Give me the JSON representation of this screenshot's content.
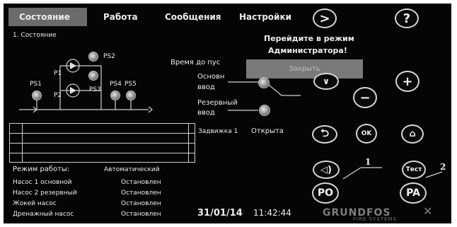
{
  "tabs": [
    {
      "label": "Состояние"
    },
    {
      "label": "Работа"
    },
    {
      "label": "Сообщения"
    },
    {
      "label": "Настройки"
    }
  ],
  "breadcrumb": "1. Состояние",
  "diagram": {
    "ps1": "PS1",
    "ps2": "PS2",
    "ps3": "PS3",
    "ps4": "PS4",
    "ps5": "PS5",
    "p1": "P1",
    "p2": "P2"
  },
  "admin_prompt": {
    "line1": "Перейдите в режим",
    "line2": "Администратора!",
    "close_label": "Закрыть"
  },
  "time_label": "Время до пус",
  "inputs": {
    "main_line1": "Основн",
    "main_line2": "ввод",
    "reserve_line1": "Резервный",
    "reserve_line2": "ввод"
  },
  "valve": {
    "label": "Задвижка 1",
    "value": "Открыта"
  },
  "mode": {
    "label": "Режим работы:",
    "value": "Автоматический"
  },
  "pumps": [
    {
      "name": "Насос 1   основной",
      "status": "Остановлен"
    },
    {
      "name": "Насос 2   резервный",
      "status": "Остановлен"
    },
    {
      "name": "Жокей насос",
      "status": "Остановлен"
    },
    {
      "name": "Дренажный насос",
      "status": "Остановлен"
    }
  ],
  "datetime": {
    "date": "31/01/14",
    "time": "11:42:44"
  },
  "buttons": {
    "next": ">",
    "help": "?",
    "plus": "+",
    "minus": "−",
    "ok": "OK",
    "test": "Тест",
    "po": "PO",
    "pa": "PA"
  },
  "callouts": {
    "one": "1",
    "two": "2"
  },
  "brand": {
    "name": "GRUNDFOS",
    "sub": "FIRE SYSTEMS"
  }
}
